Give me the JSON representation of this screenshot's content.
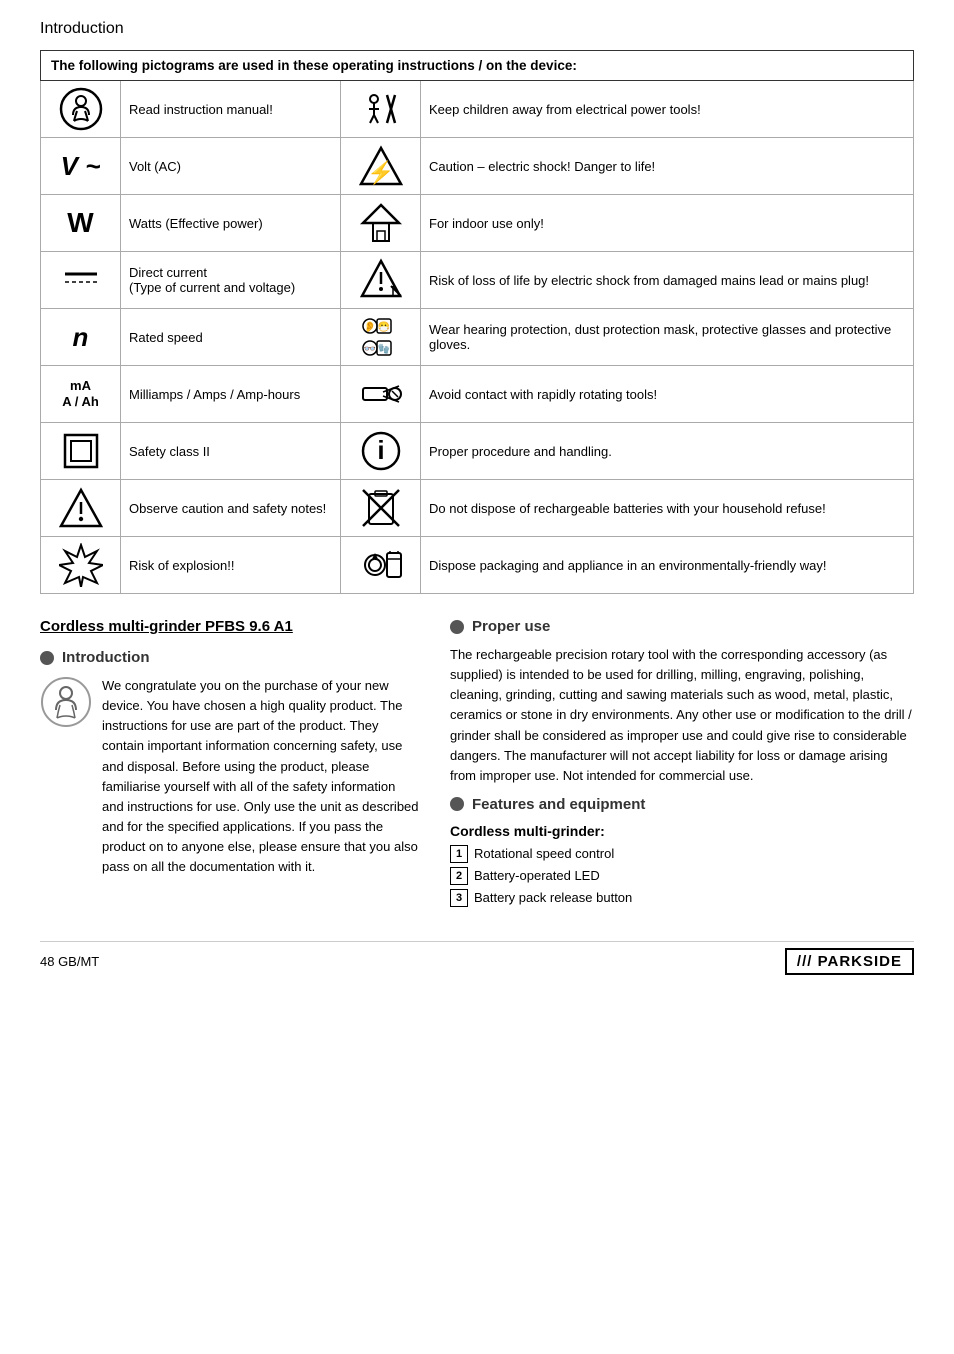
{
  "header": {
    "title": "Introduction"
  },
  "table": {
    "header": "The following pictograms are used in these operating instructions / on the device:",
    "rows": [
      {
        "left_icon": "read-manual-icon",
        "left_text": "Read instruction manual!",
        "right_icon": "keep-children-away-icon",
        "right_text": "Keep children away from electrical power tools!"
      },
      {
        "left_icon": "volt-ac-icon",
        "left_text": "Volt (AC)",
        "right_icon": "caution-electric-shock-icon",
        "right_text": "Caution – electric shock! Danger to life!"
      },
      {
        "left_icon": "watts-icon",
        "left_text": "Watts (Effective power)",
        "right_icon": "indoor-use-icon",
        "right_text": "For indoor use only!"
      },
      {
        "left_icon": "direct-current-icon",
        "left_text": "Direct current\n(Type of current and voltage)",
        "right_icon": "electric-shock-mains-icon",
        "right_text": "Risk of loss of life by electric shock from damaged mains lead or mains plug!"
      },
      {
        "left_icon": "rated-speed-icon",
        "left_text": "Rated speed",
        "right_icon": "hearing-protection-icon",
        "right_text": "Wear hearing protection, dust protection mask, protective glasses and protective gloves."
      },
      {
        "left_icon": "milliamps-icon",
        "left_text": "Milliamps / Amps / Amp-hours",
        "right_icon": "rotating-tools-icon",
        "right_text": "Avoid contact with rapidly rotating tools!"
      },
      {
        "left_icon": "safety-class-icon",
        "left_text": "Safety class II",
        "right_icon": "proper-procedure-icon",
        "right_text": "Proper procedure and handling."
      },
      {
        "left_icon": "caution-notes-icon",
        "left_text": "Observe caution and safety notes!",
        "right_icon": "no-dispose-batteries-icon",
        "right_text": "Do not dispose of rechargeable batteries with your household refuse!"
      },
      {
        "left_icon": "explosion-icon",
        "left_text": "Risk of explosion!!",
        "right_icon": "eco-dispose-icon",
        "right_text": "Dispose packaging and appliance in an environmentally-friendly way!"
      }
    ]
  },
  "product_title": "Cordless multi-grinder PFBS 9.6 A1",
  "sections": {
    "introduction": {
      "heading": "Introduction",
      "body": "We congratulate you on the purchase of your new device. You have chosen a high quality product. The instructions for use are part of the product. They contain important information concerning safety, use and disposal. Before using the product, please familiarise yourself with all of the safety information and instructions for use. Only use the unit as described and for the specified applications. If you pass the product on to anyone else, please ensure that you also pass on all the documentation with it."
    },
    "proper_use": {
      "heading": "Proper use",
      "body": "The rechargeable precision rotary tool with the corresponding accessory (as supplied) is intended to be used for drilling, milling, engraving, polishing, cleaning, grinding, cutting and sawing materials such as wood, metal, plastic, ceramics or stone in dry environments. Any other use or modification to the drill / grinder shall be considered as improper use and could give rise to considerable dangers. The manufacturer will not accept liability for loss or damage arising from improper use. Not intended for commercial use."
    },
    "features": {
      "heading": "Features and equipment",
      "subheading": "Cordless multi-grinder:",
      "items": [
        {
          "num": "1",
          "text": "Rotational speed control"
        },
        {
          "num": "2",
          "text": "Battery-operated LED"
        },
        {
          "num": "3",
          "text": "Battery pack release button"
        }
      ]
    }
  },
  "footer": {
    "page": "48   GB/MT",
    "brand": "/// PARKSIDE"
  }
}
